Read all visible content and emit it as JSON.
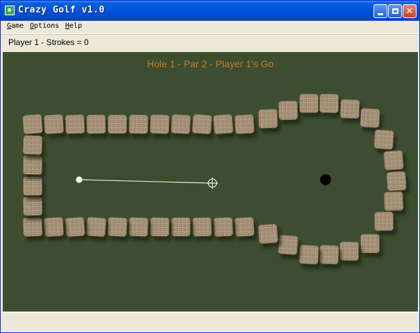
{
  "window": {
    "title": "Crazy Golf v1.0"
  },
  "menu": {
    "items": [
      "Game",
      "Options",
      "Help"
    ]
  },
  "status": {
    "text": "Player 1 - Strokes = 0"
  },
  "course": {
    "hole_label": "Hole 1 - Par 2 - Player 1's Go",
    "colors": {
      "grass": "#3c4e2f",
      "label": "#c37a2a",
      "rock": "#a59277",
      "hole": "#050505",
      "ball": "#ffffff",
      "aim_line": "#e8e8e8"
    },
    "rock_count": 40
  }
}
